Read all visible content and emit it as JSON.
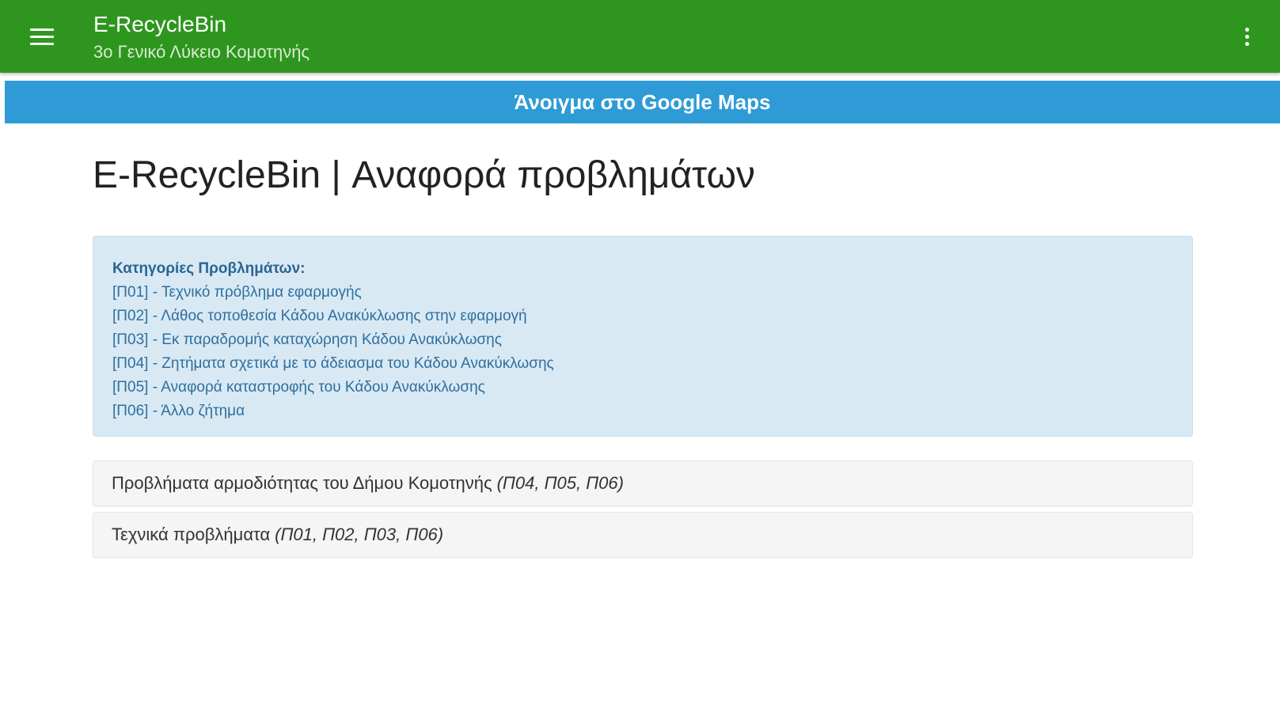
{
  "appbar": {
    "title": "E-RecycleBin",
    "subtitle": "3ο Γενικό Λύκειο Κομοτηνής",
    "menu_icon": "hamburger-menu-icon",
    "overflow_icon": "more-vertical-icon",
    "color": "#2e961e"
  },
  "maps_button": {
    "label": "Άνοιγμα στο Google Maps",
    "color": "#2e9bd6"
  },
  "page": {
    "title": "E-RecycleBin | Αναφορά προβλημάτων"
  },
  "categories": {
    "heading": "Κατηγορίες Προβλημάτων:",
    "items": [
      "[Π01] - Τεχνικό πρόβλημα εφαρμογής",
      "[Π02] - Λάθος τοποθεσία Κάδου Ανακύκλωσης στην εφαρμογή",
      "[Π03] - Εκ παραδρομής καταχώρηση Κάδου Ανακύκλωσης",
      "[Π04] - Ζητήματα σχετικά με το άδειασμα του Κάδου Ανακύκλωσης",
      "[Π05] - Αναφορά καταστροφής του Κάδου Ανακύκλωσης",
      "[Π06] - Άλλο ζήτημα"
    ],
    "background": "#d8e9f4"
  },
  "panels": [
    {
      "label": "Προβλήματα αρμοδιότητας του Δήμου Κομοτηνής ",
      "codes": "(Π04, Π05, Π06)"
    },
    {
      "label": "Τεχνικά προβλήματα ",
      "codes": "(Π01, Π02, Π03, Π06)"
    }
  ]
}
